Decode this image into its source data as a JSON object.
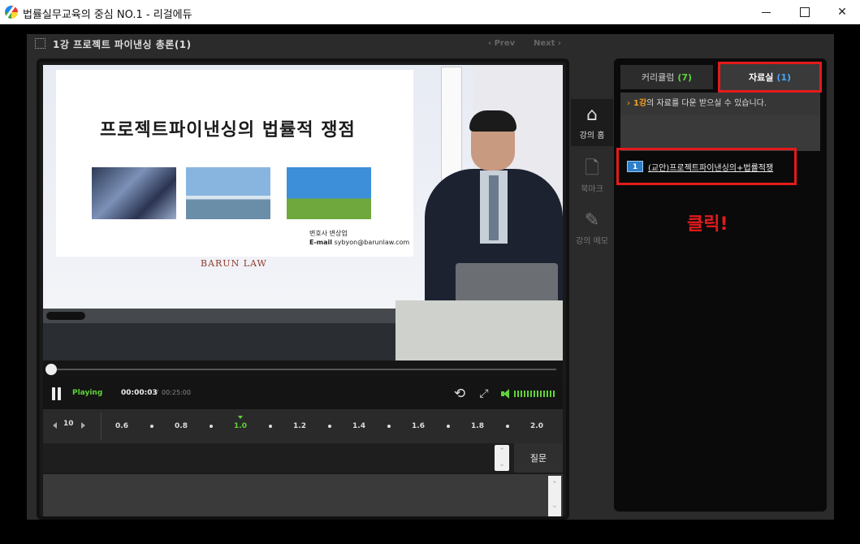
{
  "window": {
    "title": "법률실무교육의 중심 NO.1 - 리걸에듀"
  },
  "lesson": {
    "title": "1강  프로젝트 파이낸싱 총론(1)",
    "prev_label": "‹ Prev",
    "next_label": "Next ›"
  },
  "slide": {
    "title": "프로젝트파이낸싱의 법률적 쟁점",
    "speaker": "변호사 변상업",
    "email_label": "E-mail",
    "email": "sybyon@barunlaw.com",
    "logo": "BARUN LAW"
  },
  "player": {
    "status": "Playing",
    "current_time": "00:00:03",
    "separator": "/",
    "total_time": "00:25:00",
    "progress": 0.002,
    "skip_value": "10",
    "speeds": [
      "0.6",
      "0.8",
      "1.0",
      "1.2",
      "1.4",
      "1.6",
      "1.8",
      "2.0"
    ],
    "active_speed": "1.0",
    "question_label": "질문"
  },
  "side_nav": {
    "home_label": "강의 홈",
    "bookmark_label": "북마크",
    "memo_label": "강의 메모"
  },
  "panel": {
    "tab_curriculum_label": "커리큘럼",
    "tab_curriculum_count": "(7)",
    "tab_resources_label": "자료실",
    "tab_resources_count": "(1)",
    "note_highlight": "1강",
    "note_text": "의 자료를 다운 받으실 수 있습니다.",
    "file_number": "1",
    "file_name": "(교안)프로젝트파이낸싱의+법률적쟁",
    "annotation": "클릭!"
  },
  "colors": {
    "accent_green": "#5fd33a",
    "highlight_red": "#e41b1b",
    "link_blue": "#46a6ff",
    "orange": "#f0a020"
  }
}
